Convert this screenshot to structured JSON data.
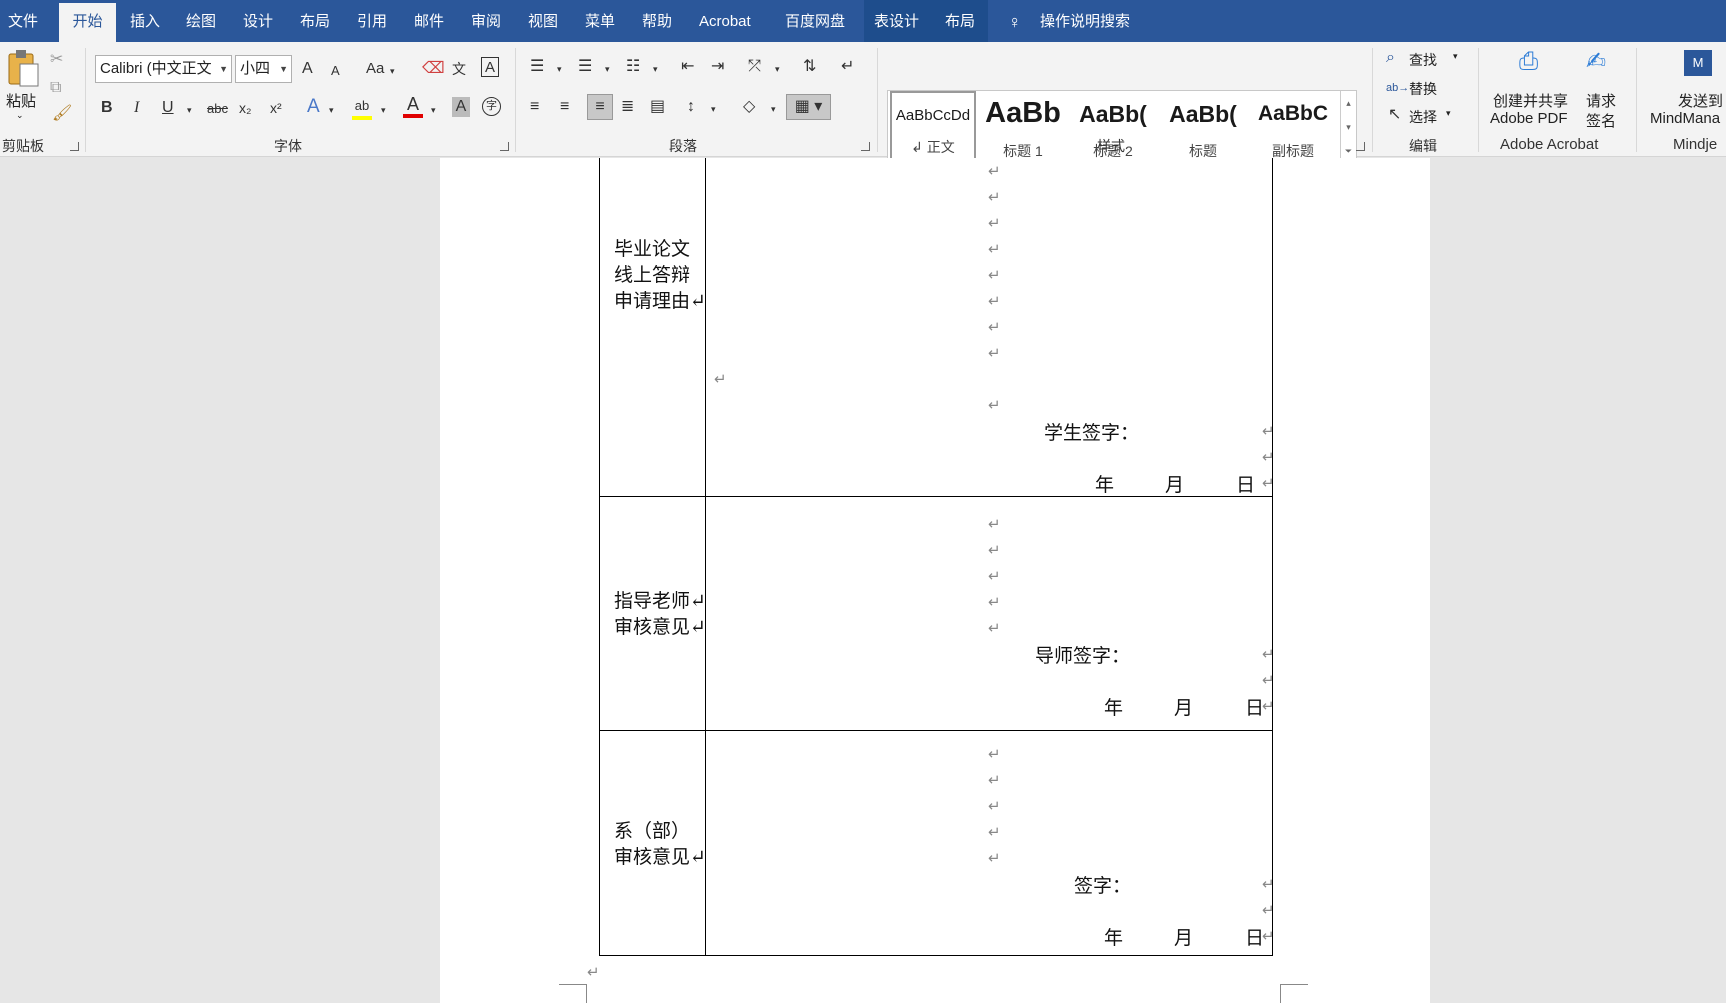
{
  "menu": {
    "file": "文件",
    "home": "开始",
    "insert": "插入",
    "draw": "绘图",
    "design": "设计",
    "layout": "布局",
    "references": "引用",
    "mailings": "邮件",
    "review": "审阅",
    "view": "视图",
    "menu": "菜单",
    "help": "帮助",
    "acrobat": "Acrobat",
    "baidu": "百度网盘",
    "table_design": "表设计",
    "table_layout": "布局",
    "tell_me": "操作说明搜索"
  },
  "ribbon": {
    "clipboard": {
      "paste": "粘贴",
      "label": "剪贴板"
    },
    "font": {
      "name": "Calibri (中文正文",
      "size": "小四",
      "label": "字体",
      "change_case": "Aa",
      "bold": "B",
      "italic": "I",
      "underline": "U",
      "strike": "abc",
      "subscript": "x₂",
      "superscript": "x²",
      "font_color": "A",
      "text_effect": "A",
      "char_shade": "A",
      "enclose": "字",
      "grow": "A",
      "shrink": "A",
      "phonetic": "文",
      "border": "A"
    },
    "paragraph": {
      "label": "段落"
    },
    "styles": {
      "label": "样式",
      "items": [
        {
          "preview": "AaBbCcDd",
          "name": "↲ 正文"
        },
        {
          "preview": "AaBb",
          "name": "标题 1"
        },
        {
          "preview": "AaBb(",
          "name": "标题 2"
        },
        {
          "preview": "AaBb(",
          "name": "标题"
        },
        {
          "preview": "AaBbC",
          "name": "副标题"
        }
      ]
    },
    "editing": {
      "label": "编辑",
      "find": "查找",
      "replace": "替换",
      "select": "选择"
    },
    "acrobat": {
      "label": "Adobe Acrobat",
      "create_share_1": "创建并共享",
      "create_share_2": "Adobe PDF",
      "request_sign_1": "请求",
      "request_sign_2": "签名"
    },
    "mindmanager": {
      "label": "Mindje",
      "send_1": "发送到",
      "send_2": "MindMana"
    }
  },
  "document": {
    "rows": [
      {
        "label_lines": [
          "毕业论文",
          "线上答辩",
          "申请理由↵"
        ],
        "sign": "学生签字：",
        "date": [
          "年",
          "月",
          "日"
        ]
      },
      {
        "label_lines": [
          "指导老师↵",
          "审核意见↵"
        ],
        "sign": "导师签字：",
        "date": [
          "年",
          "月",
          "日"
        ]
      },
      {
        "label_lines": [
          "系（部）",
          "审核意见↵"
        ],
        "sign": "签字：",
        "date": [
          "年",
          "月",
          "日"
        ]
      }
    ],
    "para_mark": "↵"
  },
  "colors": {
    "brand": "#2b579a",
    "highlight": "#ffff00",
    "font_red": "#e00000"
  }
}
